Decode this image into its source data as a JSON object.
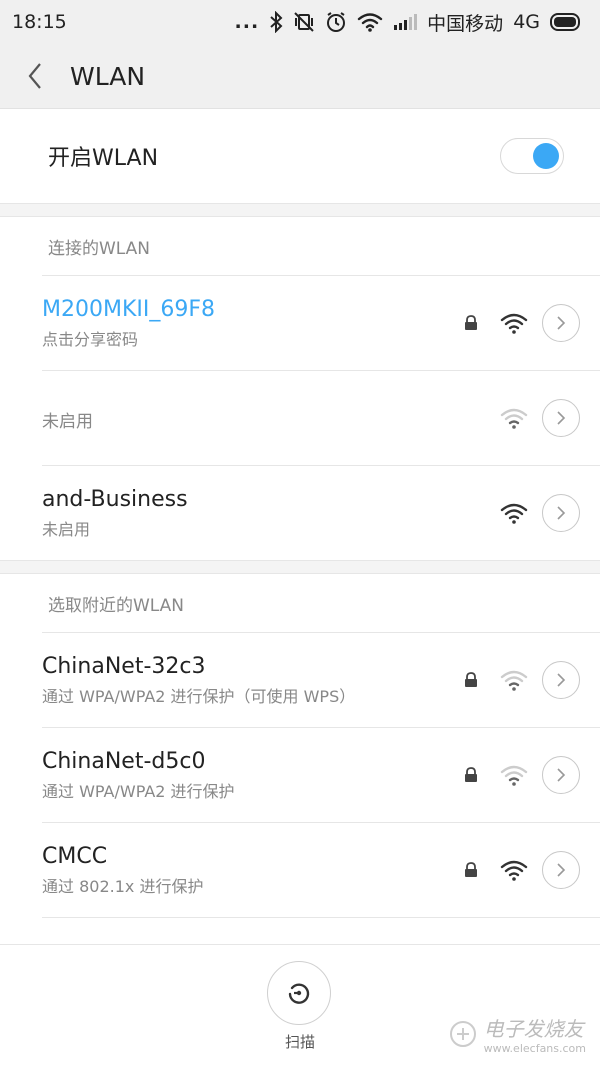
{
  "status_bar": {
    "time": "18:15",
    "dots": "...",
    "carrier": "中国移动",
    "network": "4G"
  },
  "header": {
    "title": "WLAN"
  },
  "wlan_toggle": {
    "label": "开启WLAN",
    "on": true
  },
  "connected_section": {
    "title": "连接的WLAN",
    "items": [
      {
        "name": "M200MKII_69F8",
        "sub": "点击分享密码",
        "locked": true
      },
      {
        "name": "",
        "sub": "未启用",
        "locked": false
      },
      {
        "name": "and-Business",
        "sub": "未启用",
        "locked": false
      }
    ]
  },
  "nearby_section": {
    "title": "选取附近的WLAN",
    "items": [
      {
        "name": "ChinaNet-32c3",
        "sub": "通过 WPA/WPA2 进行保护（可使用 WPS）",
        "locked": true
      },
      {
        "name": "ChinaNet-d5c0",
        "sub": "通过 WPA/WPA2 进行保护",
        "locked": true
      },
      {
        "name": "CMCC",
        "sub": "通过 802.1x 进行保护",
        "locked": true
      }
    ]
  },
  "bottom_bar": {
    "scan_label": "扫描"
  },
  "watermark": {
    "text": "电子发烧友",
    "url": "www.elecfans.com"
  },
  "colors": {
    "accent": "#3ba8f5"
  },
  "icons": [
    "bluetooth-icon",
    "vibrate-icon",
    "alarm-icon",
    "wifi-icon",
    "signal-icon",
    "battery-icon",
    "back-icon",
    "lock-icon",
    "wifi-signal-icon",
    "chevron-right-icon",
    "scan-icon"
  ]
}
